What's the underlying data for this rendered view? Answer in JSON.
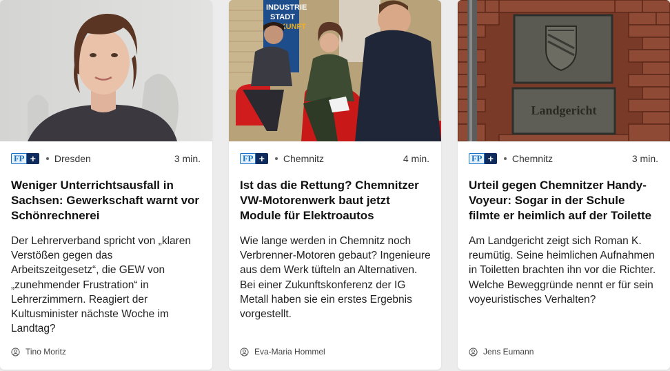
{
  "articles": [
    {
      "badge": {
        "fp": "FP",
        "plus": "+"
      },
      "location": "Dresden",
      "read_time": "3 min.",
      "headline": "Weniger Unterrichtsausfall in Sachsen: Gewerkschaft warnt vor Schönrechnerei",
      "teaser": "Der Lehrerverband spricht von „klaren Verstößen gegen das Arbeitszeitgesetz“, die GEW von „zunehmender Frustration“ in Lehrerzimmern. Reagiert der Kultusminister nächste Woche im Landtag?",
      "author": "Tino Moritz"
    },
    {
      "badge": {
        "fp": "FP",
        "plus": "+"
      },
      "location": "Chemnitz",
      "read_time": "4 min.",
      "headline": "Ist das die Rettung? Chemnitzer VW-Motorenwerk baut jetzt Module für Elektroautos",
      "teaser": "Wie lange werden in Chemnitz noch Verbrenner-Motoren gebaut? Ingenieure aus dem Werk tüfteln an Alternativen. Bei einer Zukunftskonferenz der IG Metall haben sie ein erstes Ergebnis vorgestellt.",
      "author": "Eva-Maria Hommel",
      "banner_text": "INDUSTRIE STADT ZUKUNFT"
    },
    {
      "badge": {
        "fp": "FP",
        "plus": "+"
      },
      "location": "Chemnitz",
      "read_time": "3 min.",
      "headline": "Urteil gegen Chemnitzer Handy-Voyeur: Sogar in der Schule filmte er heimlich auf der Toilette",
      "teaser": "Am Landgericht zeigt sich Roman K. reumütig. Seine heimlichen Aufnahmen in Toiletten brachten ihn vor die Richter. Welche Beweggründe nennt er für sein voyeuristisches Verhalten?",
      "author": "Jens Eumann",
      "plaque_text": "Landgericht"
    }
  ],
  "colors": {
    "fp_blue": "#1470c8",
    "fp_navy": "#0f2a5c",
    "card_bg": "#ffffff",
    "page_bg": "#ececec"
  }
}
